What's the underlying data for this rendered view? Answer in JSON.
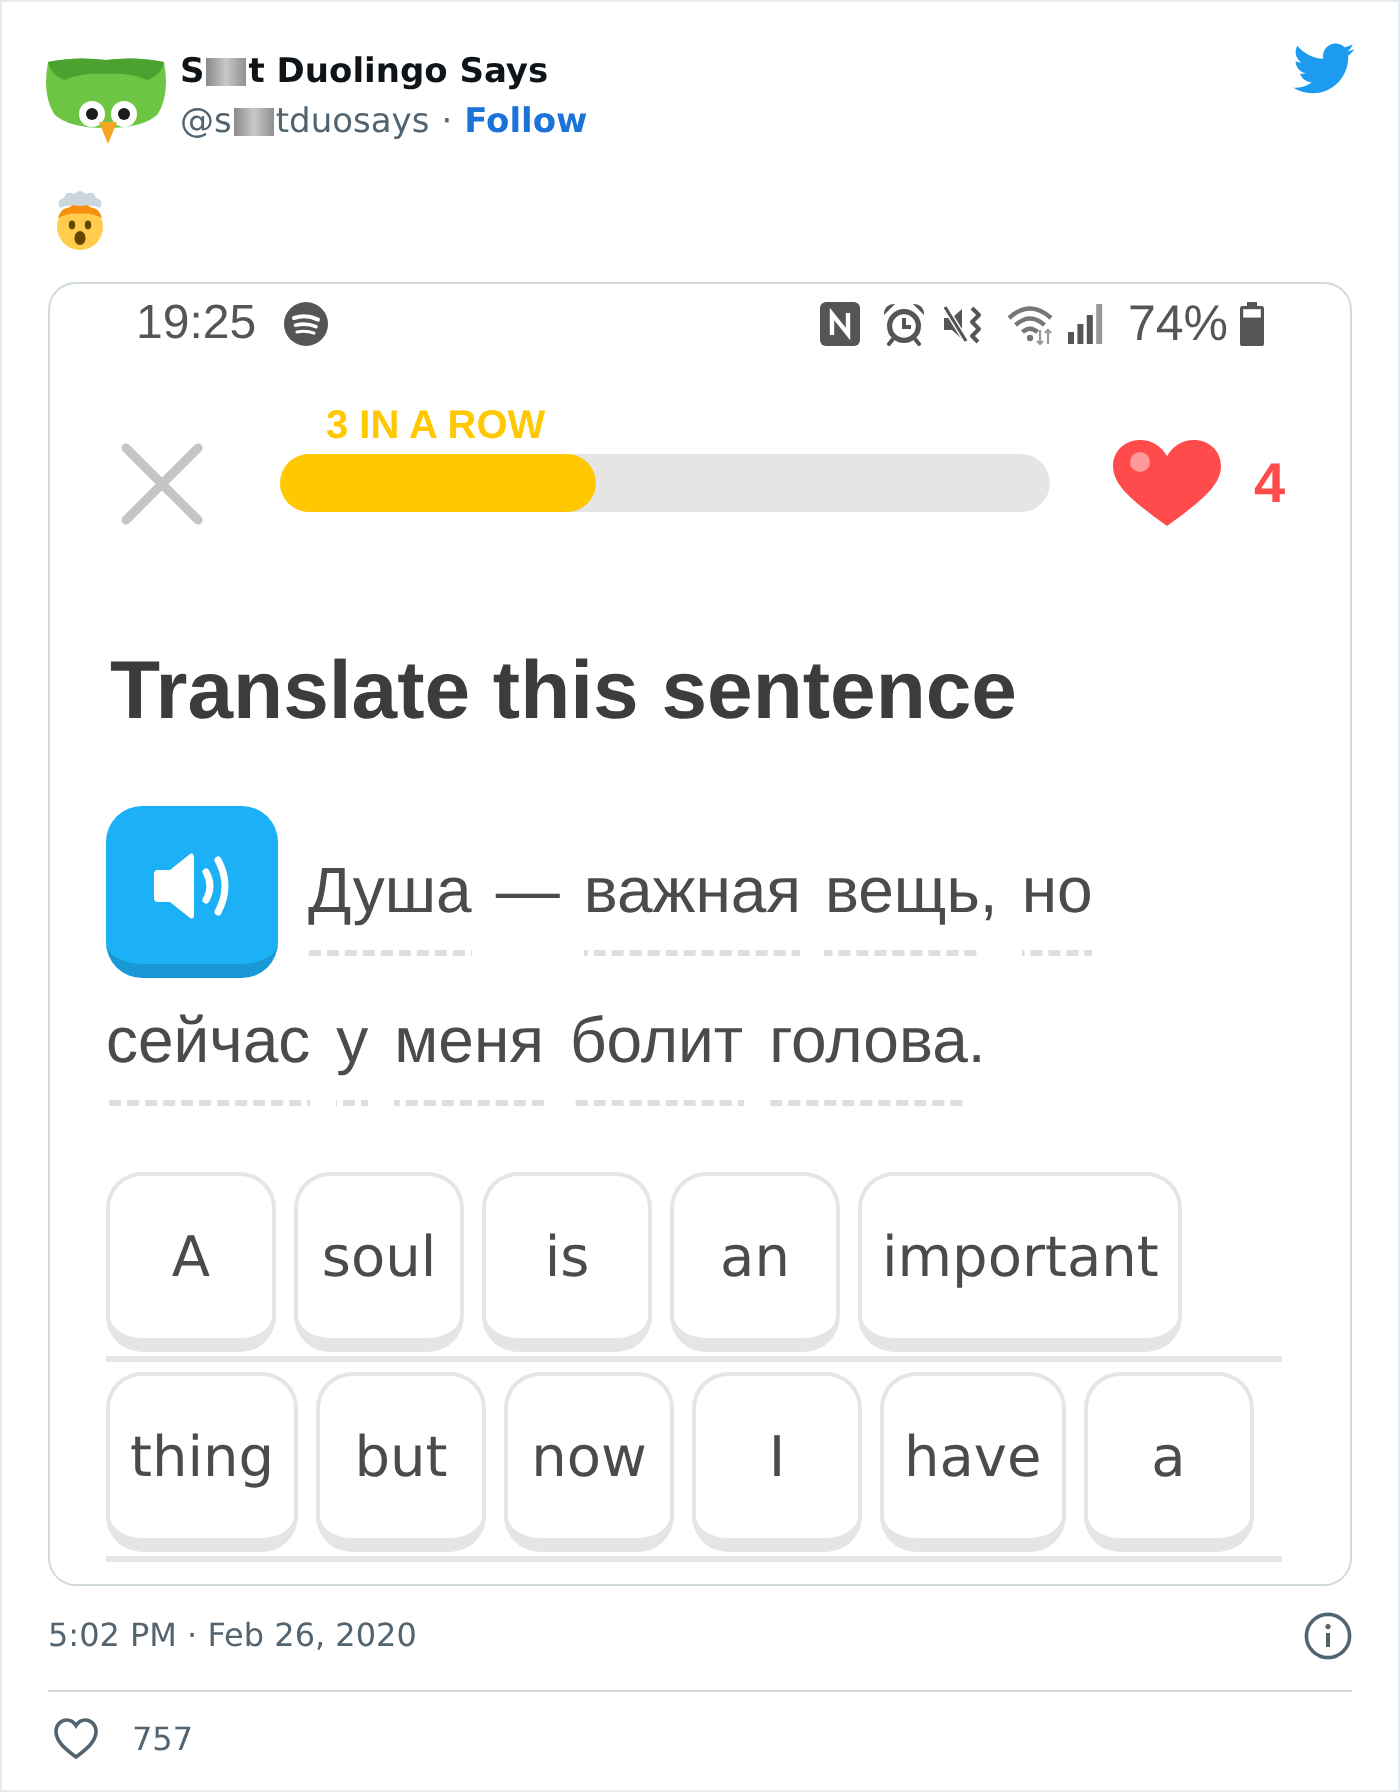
{
  "author": {
    "name_parts": [
      "S",
      "t Duolingo Says"
    ],
    "handle_parts": [
      "@s",
      "tduosays"
    ],
    "separator": "·",
    "follow": "Follow"
  },
  "screenshot": {
    "status_bar": {
      "time": "19:25",
      "battery": "74%"
    },
    "lesson": {
      "streak": "3 IN A ROW",
      "progress": {
        "level": 0.41
      },
      "hearts": "4",
      "title": "Translate this sentence",
      "sentence_lines": [
        [
          {
            "text": "Душа",
            "hint": true
          },
          {
            "text": "—",
            "hint": false
          },
          {
            "text": "важная",
            "hint": true
          },
          {
            "text": "вещь",
            "hint": true,
            "punct": ","
          },
          {
            "text": "но",
            "hint": true
          }
        ],
        [
          {
            "text": "сейчас",
            "hint": true
          },
          {
            "text": "у",
            "hint": true
          },
          {
            "text": "меня",
            "hint": true
          },
          {
            "text": "болит",
            "hint": true
          },
          {
            "text": "голова",
            "hint": true,
            "punct": "."
          }
        ]
      ],
      "answer_lines": [
        [
          "A",
          "soul",
          "is",
          "an",
          "important"
        ],
        [
          "thing",
          "but",
          "now",
          "I",
          "have",
          "a"
        ]
      ]
    }
  },
  "timestamp": "5:02 PM · Feb 26, 2020",
  "likes": "757"
}
